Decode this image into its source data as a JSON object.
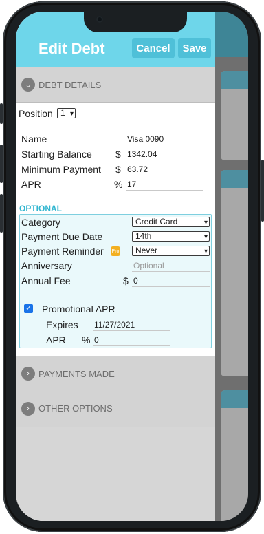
{
  "header": {
    "title": "Edit Debt",
    "cancel_label": "Cancel",
    "save_label": "Save"
  },
  "sections": {
    "debt_details": "DEBT DETAILS",
    "payments_made": "PAYMENTS MADE",
    "other_options": "OTHER OPTIONS"
  },
  "position": {
    "label": "Position",
    "value": "1"
  },
  "fields": {
    "name": {
      "label": "Name",
      "value": "Visa 0090"
    },
    "starting_balance": {
      "label": "Starting Balance",
      "prefix": "$",
      "value": "1342.04"
    },
    "minimum_payment": {
      "label": "Minimum Payment",
      "prefix": "$",
      "value": "63.72"
    },
    "apr": {
      "label": "APR",
      "prefix": "%",
      "value": "17"
    }
  },
  "optional": {
    "heading": "OPTIONAL",
    "category": {
      "label": "Category",
      "value": "Credit Card"
    },
    "due_date": {
      "label": "Payment Due Date",
      "value": "14th"
    },
    "reminder": {
      "label": "Payment Reminder",
      "badge": "Pro",
      "value": "Never"
    },
    "anniversary": {
      "label": "Anniversary",
      "placeholder": "Optional"
    },
    "annual_fee": {
      "label": "Annual Fee",
      "prefix": "$",
      "value": "0"
    },
    "promo": {
      "checked": true,
      "label": "Promotional APR",
      "expires_label": "Expires",
      "expires_value": "11/27/2021",
      "apr_label": "APR",
      "apr_prefix": "%",
      "apr_value": "0"
    }
  },
  "colors": {
    "header": "#6ed6ea",
    "accent": "#31b6d0",
    "section_bg": "#d3d3d3",
    "optional_bg": "#eaf9fb"
  }
}
